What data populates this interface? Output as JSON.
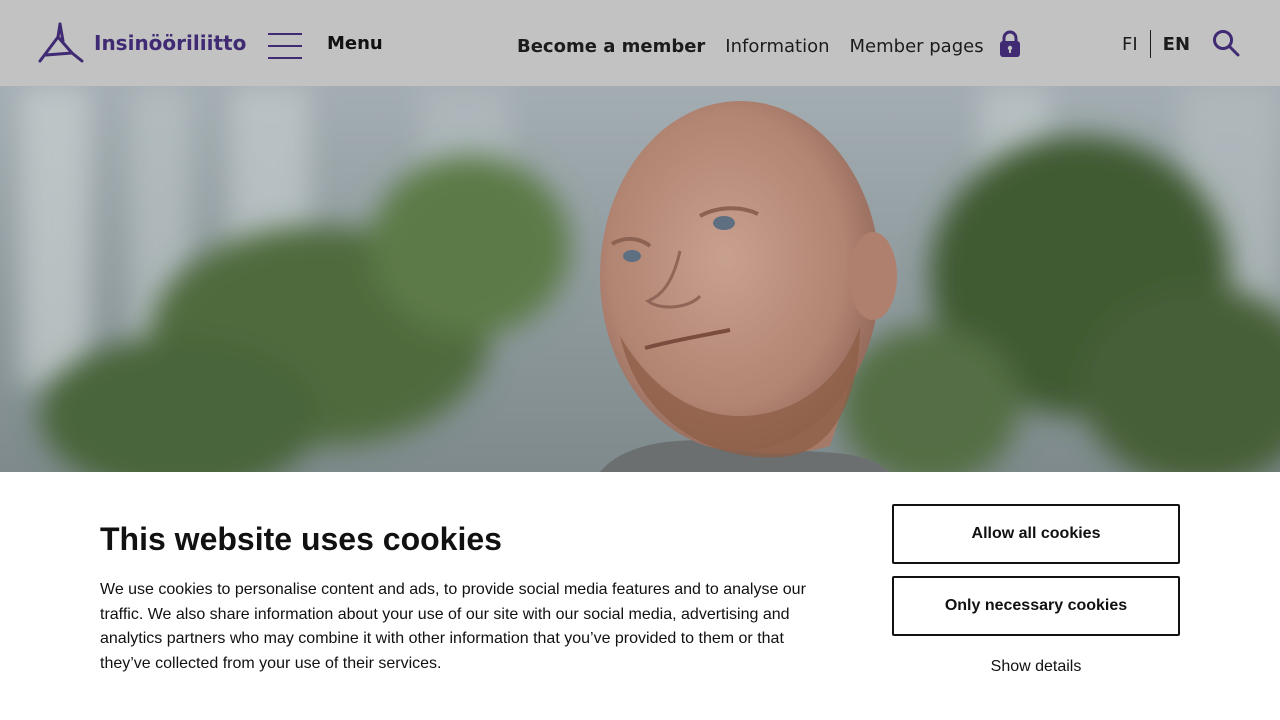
{
  "brand": {
    "name": "Insinööriliitto",
    "accent_color": "#3f2a73",
    "logo_icon": "triangular-people-logo-icon"
  },
  "header": {
    "background_color": "#c2c2c2",
    "menu_label": "Menu",
    "menu_icon": "hamburger-icon",
    "nav": {
      "become_member": "Become a member",
      "information": "Information",
      "member_pages": "Member pages",
      "member_pages_icon": "lock-icon"
    },
    "languages": {
      "fi": "FI",
      "en": "EN",
      "active": "EN"
    },
    "search_icon": "search-icon"
  },
  "hero": {
    "image_description_icon": "hero-photo-man-outdoors"
  },
  "cookie_banner": {
    "title": "This website uses cookies",
    "body": "We use cookies to personalise content and ads, to provide social media features and to analyse our traffic. We also share information about your use of our site with our social media, advertising and analytics partners who may combine it with other information that you’ve provided to them or that they’ve collected from your use of their services.",
    "allow_all_label": "Allow all cookies",
    "necessary_only_label": "Only necessary cookies",
    "show_details_label": "Show details"
  }
}
